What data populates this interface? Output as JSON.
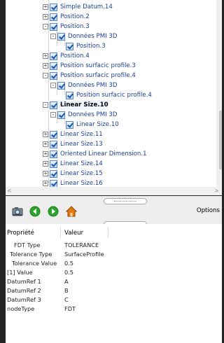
{
  "tree": {
    "items": [
      {
        "label": "Simple Datum.14",
        "bold": false,
        "state": "+"
      },
      {
        "label": "Position.2",
        "bold": false,
        "state": "+"
      },
      {
        "label": "Position.3",
        "bold": false,
        "state": "-"
      },
      {
        "label": "Données PMI 3D",
        "bold": false,
        "state": "-"
      },
      {
        "label": "Position.3",
        "bold": false,
        "state": ""
      },
      {
        "label": "Position.4",
        "bold": false,
        "state": "+"
      },
      {
        "label": "Position surfacic profile.3",
        "bold": false,
        "state": "+"
      },
      {
        "label": "Position surfacic profile.4",
        "bold": false,
        "state": "-"
      },
      {
        "label": "Données PMI 3D",
        "bold": false,
        "state": "-"
      },
      {
        "label": "Position surfacic profile.4",
        "bold": false,
        "state": ""
      },
      {
        "label": "Linear Size.10",
        "bold": true,
        "state": "-"
      },
      {
        "label": "Données PMI 3D",
        "bold": false,
        "state": "-"
      },
      {
        "label": "Linear Size.10",
        "bold": false,
        "state": ""
      },
      {
        "label": "Linear Size.11",
        "bold": false,
        "state": "+"
      },
      {
        "label": "Linear Size.13",
        "bold": false,
        "state": "+"
      },
      {
        "label": "Oriented Linear Dimension.1",
        "bold": false,
        "state": "+"
      },
      {
        "label": "Linear Size.14",
        "bold": false,
        "state": "+"
      },
      {
        "label": "Linear Size.15",
        "bold": false,
        "state": "+"
      },
      {
        "label": "Linear Size.16",
        "bold": false,
        "state": "+"
      }
    ]
  },
  "toolbar": {
    "options_label": "Options"
  },
  "properties": {
    "headers": {
      "key": "Propriété",
      "value": "Valeur"
    },
    "rows": [
      {
        "key": "FDT Type",
        "value": "TOLERANCE"
      },
      {
        "key": "Tolerance Type",
        "value": "SurfaceProfile"
      },
      {
        "key": "Tolerance Value",
        "value": "0.5"
      },
      {
        "key": "[1] Value",
        "value": "0.5"
      },
      {
        "key": "DatumRef 1",
        "value": "A"
      },
      {
        "key": "DatumRef 2",
        "value": "B"
      },
      {
        "key": "DatumRef 3",
        "value": "C"
      },
      {
        "key": "nodeType",
        "value": "FDT"
      }
    ]
  },
  "colors": {
    "background": "#232323",
    "link_blue": "#1b3f96",
    "home_orange": "#e07a10",
    "nav_green": "#2aa52a"
  }
}
